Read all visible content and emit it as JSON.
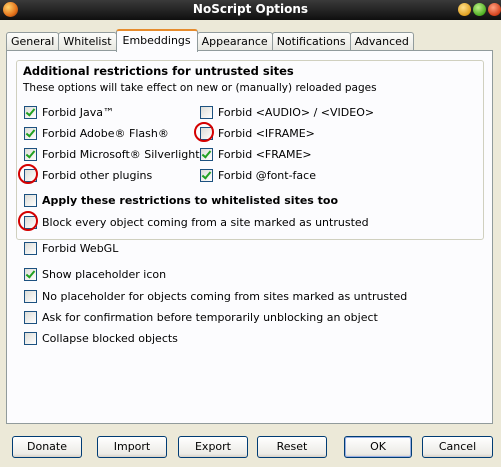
{
  "window": {
    "title": "NoScript Options"
  },
  "tabs": [
    {
      "label": "General",
      "active": false
    },
    {
      "label": "Whitelist",
      "active": false
    },
    {
      "label": "Embeddings",
      "active": true
    },
    {
      "label": "Appearance",
      "active": false
    },
    {
      "label": "Notifications",
      "active": false
    },
    {
      "label": "Advanced",
      "active": false
    }
  ],
  "embeddings": {
    "group_title": "Additional restrictions for untrusted sites",
    "group_subtitle": "These options will take effect on new or (manually) reloaded pages",
    "left_column": [
      {
        "label": "Forbid Java™",
        "checked": true,
        "highlighted": false
      },
      {
        "label": "Forbid Adobe® Flash®",
        "checked": true,
        "highlighted": false
      },
      {
        "label": "Forbid Microsoft® Silverlight™",
        "checked": true,
        "highlighted": false
      },
      {
        "label": "Forbid other plugins",
        "checked": false,
        "highlighted": true
      }
    ],
    "right_column": [
      {
        "label": "Forbid <AUDIO> / <VIDEO>",
        "checked": false,
        "highlighted": false
      },
      {
        "label": "Forbid <IFRAME>",
        "checked": false,
        "highlighted": true
      },
      {
        "label": "Forbid <FRAME>",
        "checked": true,
        "highlighted": false
      },
      {
        "label": "Forbid @font-face",
        "checked": true,
        "highlighted": false
      }
    ],
    "apply_whitelisted": {
      "label": "Apply these restrictions to whitelisted sites too",
      "checked": false
    },
    "block_untrusted": {
      "label": "Block every object coming from a site marked as untrusted",
      "checked": false,
      "highlighted": true
    },
    "forbid_webgl": {
      "label": "Forbid WebGL",
      "checked": false
    },
    "show_placeholder": {
      "label": "Show placeholder icon",
      "checked": true
    },
    "no_placeholder": {
      "label": "No placeholder for objects coming from sites marked as untrusted",
      "checked": false
    },
    "ask_confirmation": {
      "label": "Ask for confirmation before temporarily unblocking an object",
      "checked": false
    },
    "collapse_blocked": {
      "label": "Collapse blocked objects",
      "checked": false
    }
  },
  "buttons": {
    "donate": "Donate",
    "import": "Import",
    "export": "Export",
    "reset": "Reset",
    "ok": "OK",
    "cancel": "Cancel"
  },
  "colors": {
    "highlight_circle": "#d40000",
    "check_mark": "#21a121",
    "active_tab_accent": "#e68b2c"
  }
}
